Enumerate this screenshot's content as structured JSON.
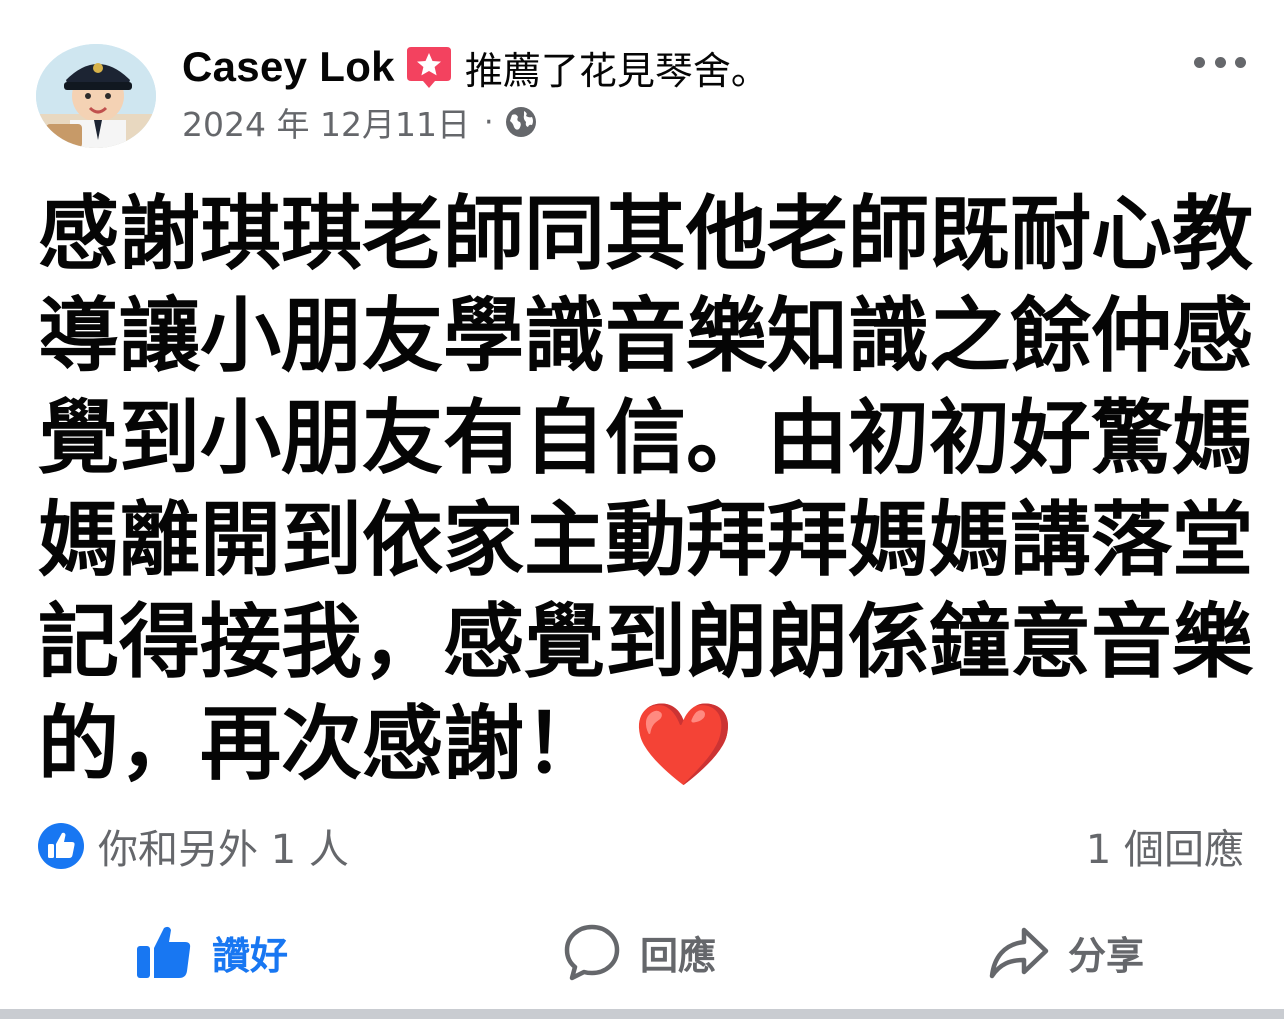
{
  "header": {
    "author": "Casey Lok",
    "action": "推薦了花見琴舍。",
    "date": "2024 年 12月11日",
    "separator": "·",
    "privacy_icon": "globe-icon",
    "recommend_icon": "recommend-star-icon",
    "more_icon": "more-horizontal-icon"
  },
  "post": {
    "text": "感謝琪琪老師同其他老師既耐心教導讓小朋友學識音樂知識之餘仲感覺到小朋友有自信。由初初好驚媽媽離開到依家主動拜拜媽媽講落堂記得接我，感覺到朗朗係鐘意音樂的，再次感謝！ ❤️"
  },
  "reactions": {
    "icon": "like-badge-icon",
    "summary": "你和另外 1 人",
    "comments": "1 個回應"
  },
  "actions": {
    "like": "讚好",
    "comment": "回應",
    "share": "分享"
  },
  "colors": {
    "accent": "#1877f2",
    "secondary_text": "#65676b",
    "recommend": "#f3425f",
    "divider": "#c9ccd1"
  }
}
